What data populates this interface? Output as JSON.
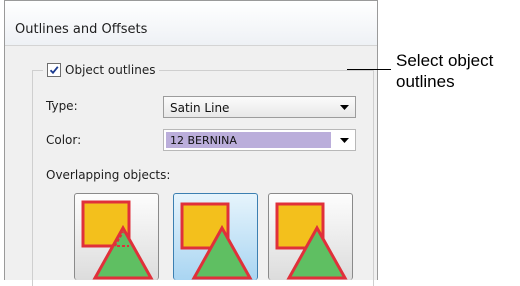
{
  "panel": {
    "title": "Outlines and Offsets",
    "object_outlines": {
      "label": "Object outlines",
      "checked": true
    },
    "type": {
      "label": "Type:",
      "value": "Satin Line"
    },
    "color": {
      "label": "Color:",
      "value": "12 BERNINA",
      "swatch": "#bbaedb"
    },
    "overlapping": {
      "label": "Overlapping objects:",
      "options": [
        "overlap-outline-behind",
        "overlap-outline-none",
        "overlap-outline-front"
      ],
      "selected_index": 1
    }
  },
  "callout": {
    "line1": "Select object",
    "line2": "outlines"
  },
  "colors": {
    "square_fill": "#f3c01c",
    "square_stroke": "#e0303a",
    "triangle_fill": "#5fbf62",
    "triangle_stroke": "#e0303a",
    "selected_button": "#a9d5f2"
  }
}
